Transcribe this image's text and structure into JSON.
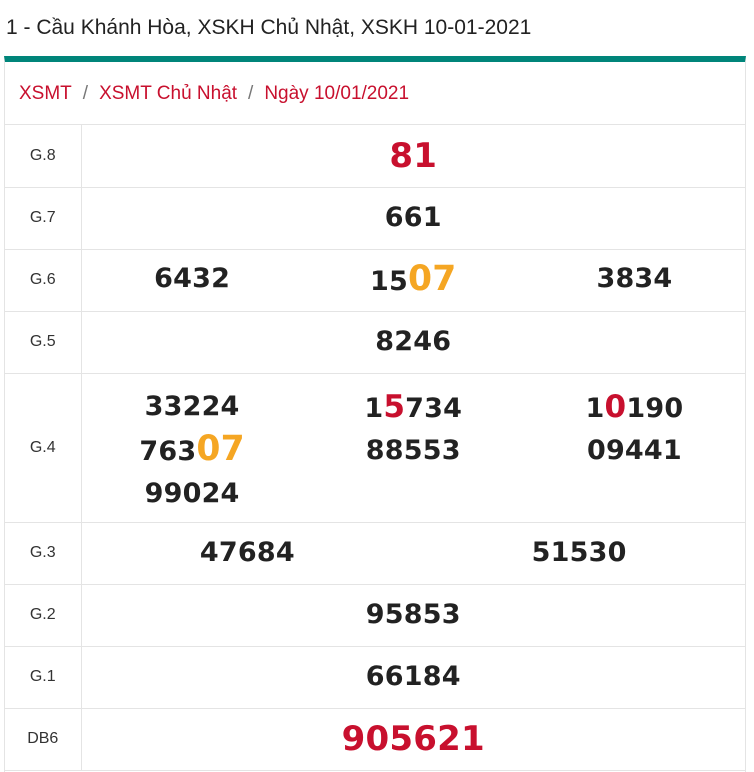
{
  "page_title": "1 - Cầu Khánh Hòa, XSKH Chủ Nhật, XSKH 10-01-2021",
  "breadcrumb": [
    "XSMT",
    "XSMT Chủ Nhật",
    "Ngày 10/01/2021"
  ],
  "breadcrumb_sep": "/",
  "colors": {
    "accent_bar": "#00857a",
    "red": "#c8102e",
    "highlight": "#f5a623"
  },
  "prizes": {
    "g8": {
      "label": "G.8",
      "values": [
        "81"
      ]
    },
    "g7": {
      "label": "G.7",
      "values": [
        "661"
      ]
    },
    "g6": {
      "label": "G.6",
      "values": [
        "6432",
        "1507",
        "3834"
      ]
    },
    "g5": {
      "label": "G.5",
      "values": [
        "8246"
      ]
    },
    "g4": {
      "label": "G.4",
      "values": [
        "33224",
        "76307",
        "99024",
        "15734",
        "88553",
        "10190",
        "09441"
      ]
    },
    "g3": {
      "label": "G.3",
      "values": [
        "47684",
        "51530"
      ]
    },
    "g2": {
      "label": "G.2",
      "values": [
        "95853"
      ]
    },
    "g1": {
      "label": "G.1",
      "values": [
        "66184"
      ]
    },
    "db": {
      "label": "DB6",
      "values": [
        "905621"
      ]
    }
  }
}
